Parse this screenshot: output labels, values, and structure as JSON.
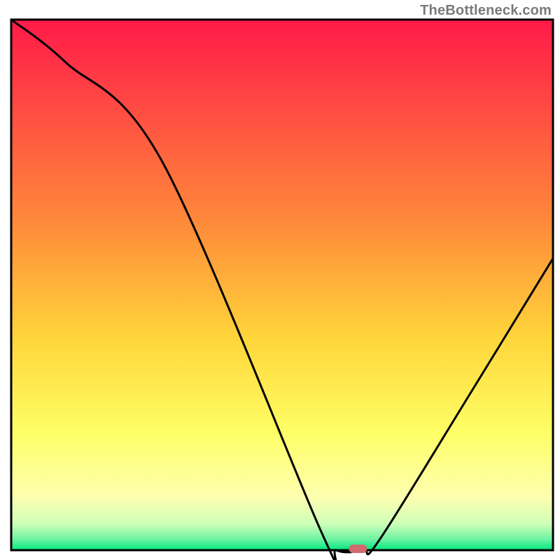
{
  "watermark": "TheBottleneck.com",
  "chart_data": {
    "type": "line",
    "title": "",
    "xlabel": "",
    "ylabel": "",
    "xlim": [
      0,
      100
    ],
    "ylim": [
      0,
      100
    ],
    "grid": false,
    "legend": false,
    "series": [
      {
        "name": "bottleneck-curve",
        "x": [
          0,
          10,
          28,
          57,
          60,
          65,
          68,
          85,
          100
        ],
        "values": [
          100,
          92,
          73,
          4,
          0,
          0,
          2,
          30,
          55
        ]
      }
    ],
    "marker": {
      "x": 64,
      "y": 0
    },
    "background_gradient_stops": [
      {
        "pct": 0,
        "color": "#ff1a49"
      },
      {
        "pct": 38,
        "color": "#ff893a"
      },
      {
        "pct": 60,
        "color": "#ffd53a"
      },
      {
        "pct": 78,
        "color": "#feff66"
      },
      {
        "pct": 90,
        "color": "#fdffb0"
      },
      {
        "pct": 95,
        "color": "#cfffb8"
      },
      {
        "pct": 98,
        "color": "#6bf2a2"
      },
      {
        "pct": 100,
        "color": "#00e77e"
      }
    ],
    "marker_color": "#cf6a6f",
    "axis_color": "#000000"
  }
}
